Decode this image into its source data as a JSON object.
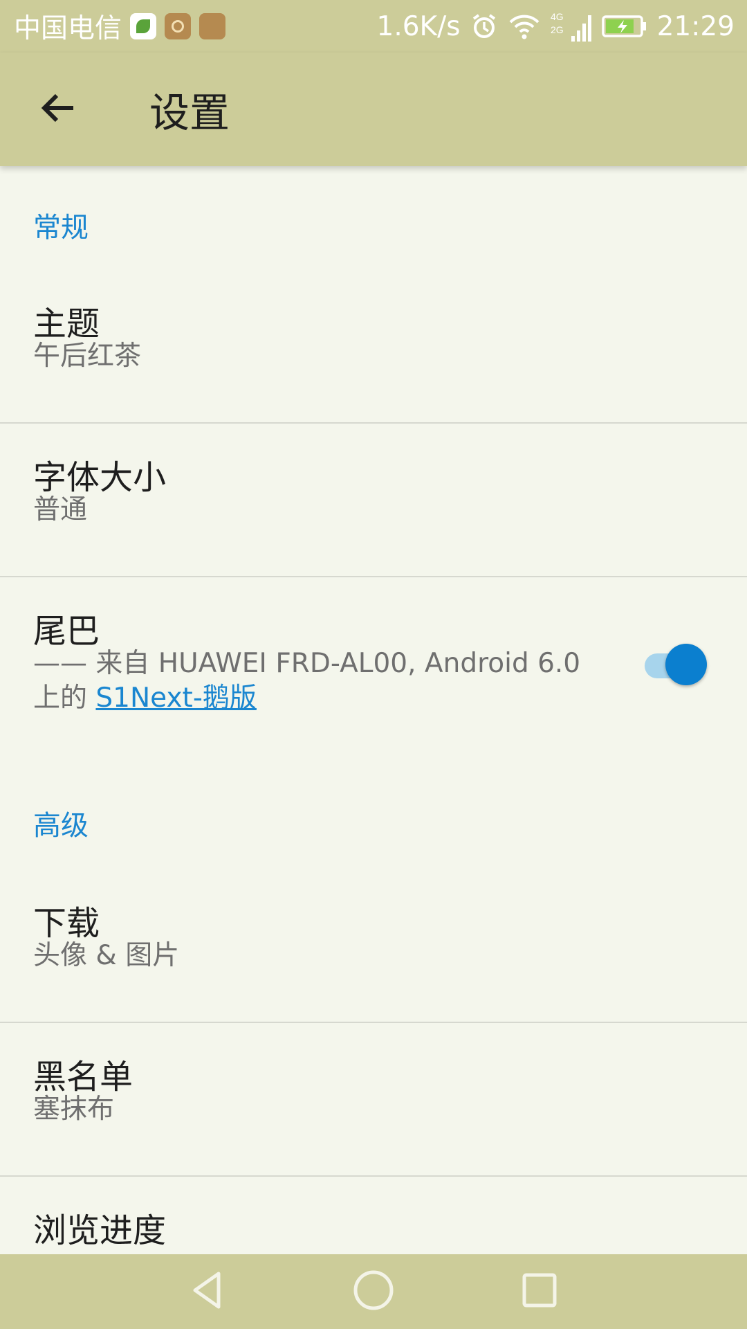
{
  "status_bar": {
    "carrier": "中国电信",
    "net_speed": "1.6K/s",
    "network_types": [
      "4G",
      "2G"
    ],
    "time": "21:29",
    "icons": [
      "leaf-app-icon",
      "health-app-icon",
      "usb-icon",
      "alarm-icon",
      "wifi-icon",
      "signal-icon",
      "battery-charging-icon"
    ]
  },
  "app_bar": {
    "title": "设置",
    "back_icon": "arrow-back-icon"
  },
  "sections": {
    "general": {
      "header": "常规",
      "theme": {
        "title": "主题",
        "summary": "午后红茶"
      },
      "font_size": {
        "title": "字体大小",
        "summary": "普通"
      },
      "signature": {
        "title": "尾巴",
        "summary_prefix": "—— 来自 HUAWEI FRD-AL00, Android 6.0",
        "summary_line2_prefix": "上的",
        "summary_link": "S1Next-鹅版",
        "enabled": true
      }
    },
    "advanced": {
      "header": "高级",
      "download": {
        "title": "下载",
        "summary": "头像 & 图片"
      },
      "blacklist": {
        "title": "黑名单",
        "summary": "塞抹布"
      },
      "read_progress": {
        "title": "浏览进度"
      }
    }
  },
  "colors": {
    "bar": "#cccc99",
    "background": "#f4f6ec",
    "accent": "#1a86d0"
  },
  "nav_bar": {
    "icons": [
      "back-triangle-icon",
      "home-circle-icon",
      "recents-square-icon"
    ]
  }
}
